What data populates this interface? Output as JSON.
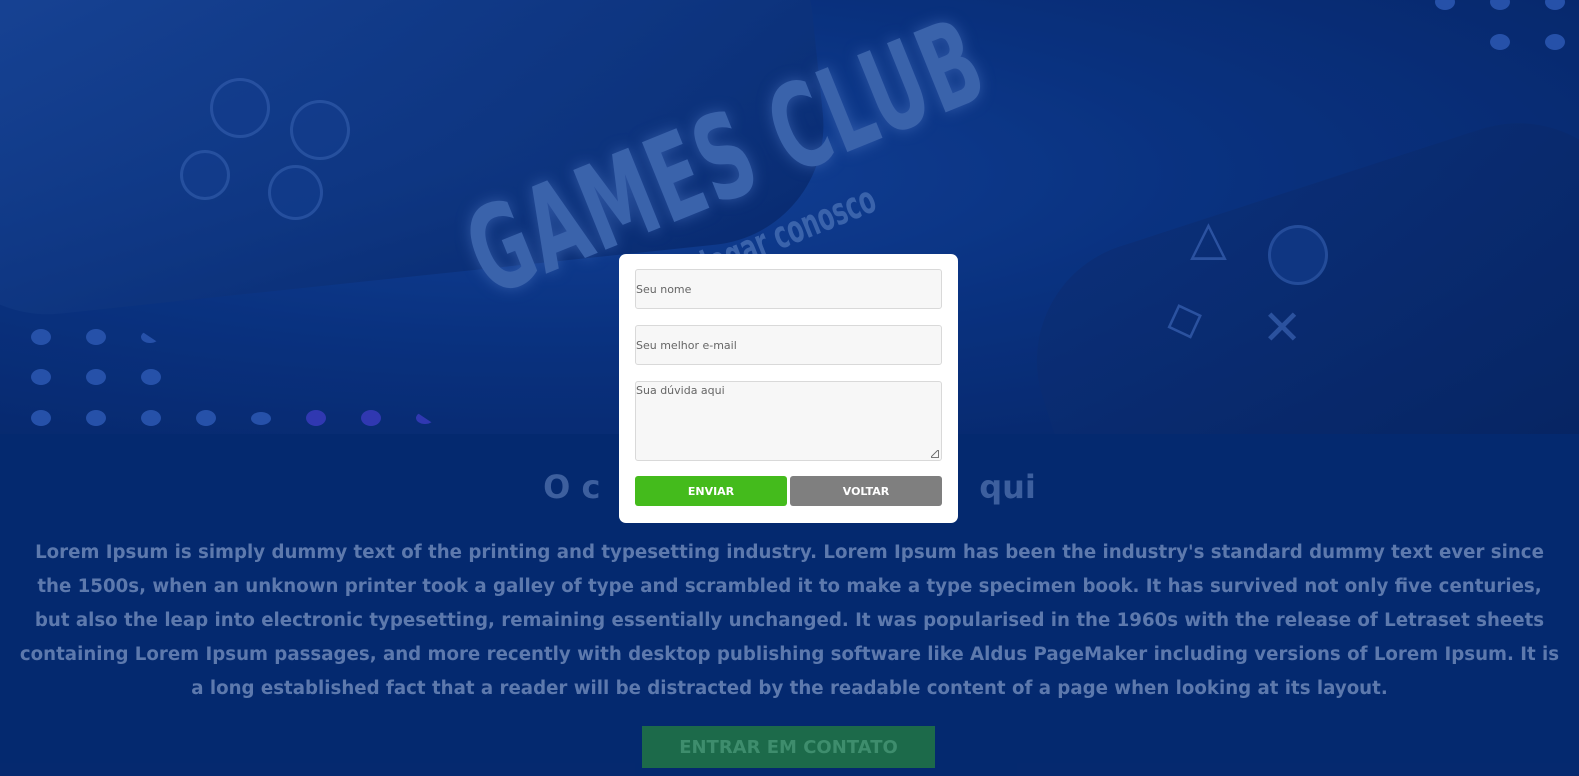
{
  "hero": {
    "logo_text": "GAMES CLUB",
    "slogan_text": "jogar conosco"
  },
  "section": {
    "title": "O c                                  qui",
    "body": "Lorem Ipsum is simply dummy text of the printing and typesetting industry. Lorem Ipsum has been the industry's standard dummy text ever since the 1500s, when an unknown printer took a galley of type and scrambled it to make a type specimen book. It has survived not only five centuries, but also the leap into electronic typesetting, remaining essentially unchanged. It was popularised in the 1960s with the release of Letraset sheets containing Lorem Ipsum passages, and more recently with desktop publishing software like Aldus PageMaker including versions of Lorem Ipsum. It is a long established fact that a reader will be distracted by the readable content of a page when looking at its layout.",
    "cta_label": "ENTRAR EM CONTATO"
  },
  "modal": {
    "name_placeholder": "Seu nome",
    "email_placeholder": "Seu melhor e-mail",
    "message_placeholder": "Sua dúvida aqui",
    "send_label": "ENVIAR",
    "back_label": "VOLTAR"
  },
  "colors": {
    "background": "#0a3684",
    "send_button": "#44bb1c",
    "back_button": "#7f7f7f",
    "cta_button": "#1c6a4a"
  }
}
